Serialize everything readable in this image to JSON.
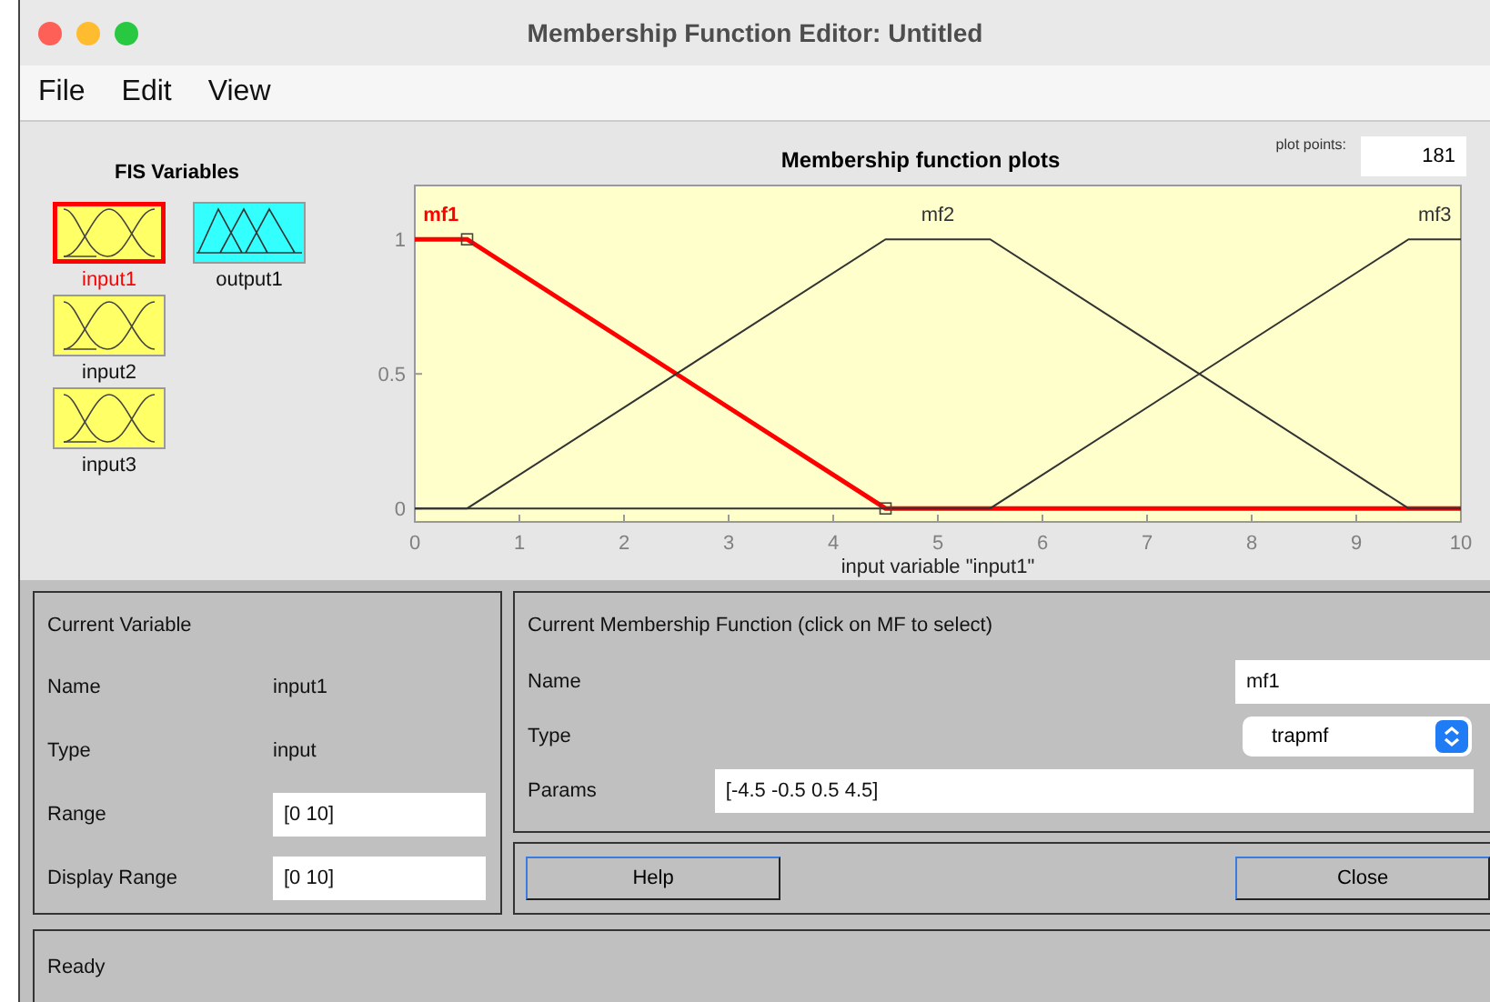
{
  "window": {
    "title": "Membership Function Editor: Untitled"
  },
  "menu": [
    "File",
    "Edit",
    "View"
  ],
  "fis_variables": {
    "title": "FIS Variables",
    "items": [
      {
        "name": "input1",
        "kind": "input",
        "selected": true
      },
      {
        "name": "output1",
        "kind": "output",
        "selected": false
      },
      {
        "name": "input2",
        "kind": "input",
        "selected": false
      },
      {
        "name": "input3",
        "kind": "input",
        "selected": false
      }
    ]
  },
  "plot": {
    "plot_points_label": "plot points:",
    "plot_points": "181",
    "chart_data": {
      "type": "line",
      "title": "Membership function plots",
      "xlabel": "input variable \"input1\"",
      "x": [
        0,
        0.5,
        4.5,
        5.5,
        9.5,
        10
      ],
      "xlim": [
        0,
        10
      ],
      "ylim": [
        -0.05,
        1.2
      ],
      "xticks": [
        0,
        1,
        2,
        3,
        4,
        5,
        6,
        7,
        8,
        9,
        10
      ],
      "yticks": [
        0,
        0.5,
        1
      ],
      "series": [
        {
          "name": "mf1",
          "color": "#ff0000",
          "values": [
            1,
            1,
            0,
            0,
            0,
            0
          ]
        },
        {
          "name": "mf2",
          "color": "#333333",
          "values": [
            0,
            0,
            1,
            1,
            0,
            0
          ]
        },
        {
          "name": "mf3",
          "color": "#333333",
          "values": [
            0,
            0,
            0,
            0,
            1,
            1
          ]
        }
      ]
    },
    "curves": [
      {
        "selected": true
      },
      {
        "selected": false
      },
      {
        "selected": false
      }
    ]
  },
  "current_variable": {
    "title": "Current Variable",
    "rows": [
      {
        "label": "Name",
        "value": "input1",
        "kind": "text"
      },
      {
        "label": "Type",
        "value": "input",
        "kind": "text"
      },
      {
        "label": "Range",
        "value": "[0 10]",
        "kind": "field"
      },
      {
        "label": "Display Range",
        "value": "[0 10]",
        "kind": "field"
      }
    ]
  },
  "current_mf": {
    "title": "Current Membership Function (click on MF to select)",
    "name": {
      "label": "Name",
      "value": "mf1"
    },
    "type": {
      "label": "Type",
      "value": "trapmf"
    },
    "params": {
      "label": "Params",
      "value": "[-4.5 -0.5 0.5 4.5]"
    }
  },
  "buttons": [
    "Help",
    "Close"
  ],
  "status": "Ready"
}
